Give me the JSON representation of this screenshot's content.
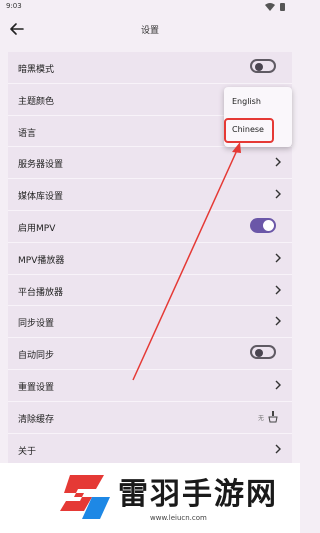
{
  "status": {
    "time": "9:03"
  },
  "header": {
    "title": "设置"
  },
  "settings": [
    {
      "label": "暗黑模式"
    },
    {
      "label": "主题颜色"
    },
    {
      "label": "语言"
    },
    {
      "label": "服务器设置"
    },
    {
      "label": "媒体库设置"
    },
    {
      "label": "启用MPV"
    },
    {
      "label": "MPV播放器"
    },
    {
      "label": "平台播放器"
    },
    {
      "label": "同步设置"
    },
    {
      "label": "自动同步"
    },
    {
      "label": "重置设置"
    },
    {
      "label": "清除缓存",
      "value": "无"
    },
    {
      "label": "关于"
    }
  ],
  "language_menu": {
    "options": [
      "English",
      "Chinese"
    ]
  },
  "watermark": {
    "brand": "雷羽手游网",
    "url": "www.leiucn.com"
  },
  "colors": {
    "accent": "#6b57a8",
    "highlight": "#e53935"
  }
}
